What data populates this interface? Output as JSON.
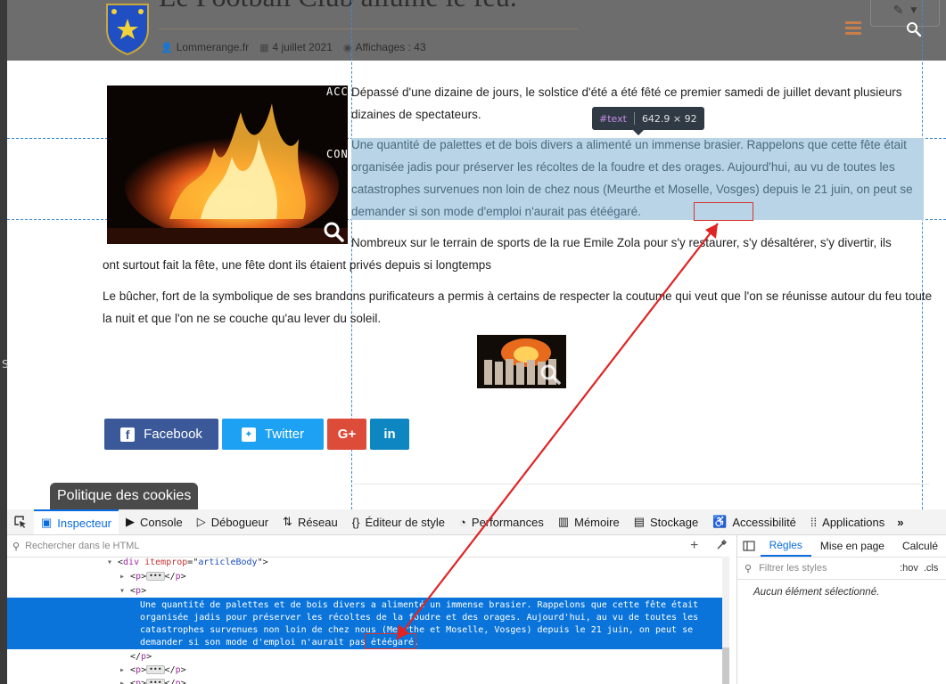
{
  "article": {
    "title": "Le Football Club allume le feu.",
    "author": "Lommerange.fr",
    "date": "4 juillet 2021",
    "views": "Affichages : 43",
    "overlay_menu": [
      "ACC",
      "CONTACT"
    ],
    "paragraph1": "Dépassé d'une dizaine de jours, le solstice d'été a été fêté ce premier samedi de juillet devant plusieurs dizaines de spectateurs.",
    "paragraph2": "Une quantité de palettes et de bois divers a alimenté un immense brasier. Rappelons que cette fête était organisée jadis pour préserver les récoltes de la foudre et des orages. Aujourd'hui, au vu de toutes les catastrophes survenues non loin de chez nous (Meurthe et Moselle, Vosges) depuis le 21 juin, on peut se demander si son mode d'emploi n'aurait pas ",
    "highlighted_word": "étéégaré.",
    "paragraph3_line1": "Nombreux sur le terrain de sports de la rue Emile Zola pour s'y restaurer, s'y désaltérer, s'y divertir, ils",
    "paragraph3_line2": "ont surtout fait la fête, une fête dont ils étaient privés depuis si longtemps",
    "paragraph4": "Le bûcher, fort de la symbolique de ses brandons purificateurs a permis à certains de respecter la coutume qui veut que l'on se réunisse autour du feu toute la nuit et que l'on ne se couche qu'au lever du soleil."
  },
  "tooltip": {
    "tag": "#text",
    "size": "642.9 × 92"
  },
  "share": {
    "facebook": "Facebook",
    "twitter": "Twitter",
    "gplus": "G+",
    "linkedin": "in"
  },
  "cookie_label": "Politique des cookies",
  "side_letter": "S",
  "devtools": {
    "tabs": [
      {
        "label": "Inspecteur",
        "icon": "inspector-icon"
      },
      {
        "label": "Console",
        "icon": "console-icon"
      },
      {
        "label": "Débogueur",
        "icon": "debugger-icon"
      },
      {
        "label": "Réseau",
        "icon": "network-icon"
      },
      {
        "label": "Éditeur de style",
        "icon": "style-editor-icon"
      },
      {
        "label": "Performances",
        "icon": "performance-icon"
      },
      {
        "label": "Mémoire",
        "icon": "memory-icon"
      },
      {
        "label": "Stockage",
        "icon": "storage-icon"
      },
      {
        "label": "Accessibilité",
        "icon": "accessibility-icon"
      },
      {
        "label": "Applications",
        "icon": "applications-icon"
      }
    ],
    "search_placeholder": "Rechercher dans le HTML",
    "tree": {
      "line1_tag": "div",
      "line1_attr": "itemprop",
      "line1_val": "articleBody",
      "p_tag": "p",
      "close_p": "p",
      "selected_text": "Une quantité de palettes et de bois divers a alimenté un immense brasier. Rappelons que cette fête était\norganisée jadis pour préserver les récoltes de la foudre et des orages. Aujourd'hui, au vu de toutes les\ncatastrophes survenues non loin de chez nous (Meurthe et Moselle, Vosges) depuis le 21 juin, on peut se\ndemander si son mode d'emploi n'aurait pas étéégaré."
    },
    "rules_tabs": [
      "Règles",
      "Mise en page",
      "Calculé"
    ],
    "filter_placeholder": "Filtrer les styles",
    "hov": ":hov",
    "cls": ".cls",
    "no_selection": "Aucun élément sélectionné."
  }
}
